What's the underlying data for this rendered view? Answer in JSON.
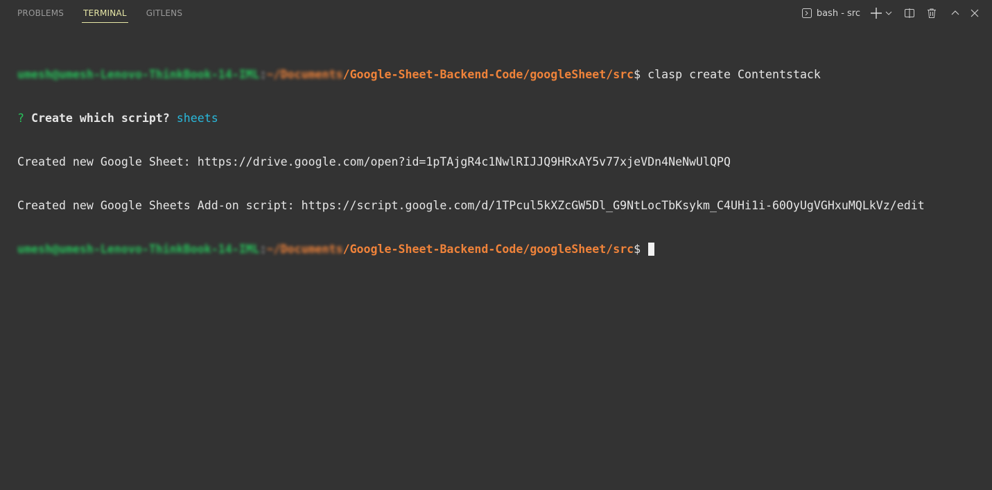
{
  "panel_tabs": [
    {
      "label": "PROBLEMS",
      "active": false
    },
    {
      "label": "TERMINAL",
      "active": true
    },
    {
      "label": "GITLENS",
      "active": false
    }
  ],
  "toolbar": {
    "shell_label": "bash - src",
    "icons": [
      "terminal-icon",
      "plus-icon",
      "chevron-down-icon",
      "split-icon",
      "trash-icon",
      "chevron-up-icon",
      "close-icon"
    ]
  },
  "terminal": {
    "prompt_user_host": "umesh@umesh-Lenovo-ThinkBook-14-IML",
    "prompt_sep": ":",
    "prompt_path_blurred": "~/Documents",
    "prompt_path": "/Google-Sheet-Backend-Code/googleSheet/src",
    "prompt_dollar": "$ ",
    "command": "clasp create Contentstack",
    "question_mark": "? ",
    "question": "Create which script?",
    "answer": "sheets",
    "output_1": "Created new Google Sheet: https://drive.google.com/open?id=1pTAjgR4c1NwlRIJJQ9HRxAY5v77xjeVDn4NeNwUlQPQ",
    "output_2": "Created new Google Sheets Add-on script: https://script.google.com/d/1TPcul5kXZcGW5Dl_G9NtLocTbKsykm_C4UHi1i-60OyUgVGHxuMQLkVz/edit"
  },
  "colors": {
    "background": "#333333",
    "prompt_user": "#27c15a",
    "prompt_path": "#f0833a",
    "answer": "#29b8db",
    "active_tab": "#e8e8a8"
  }
}
